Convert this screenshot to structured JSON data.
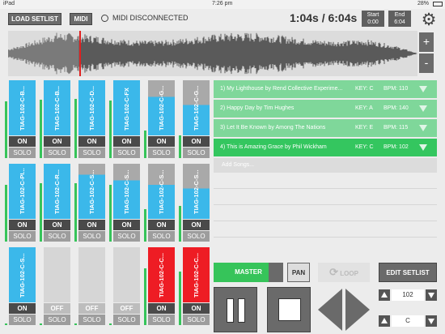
{
  "status": {
    "device": "iPad",
    "time": "7:26 pm",
    "battery": "28%"
  },
  "toolbar": {
    "load_setlist": "LOAD SETLIST",
    "midi": "MIDI",
    "midi_status": "MIDI DISCONNECTED",
    "timecode": "1:04s / 6:04s",
    "start_label": "Start",
    "start_value": "0:00",
    "end_label": "End",
    "end_value": "6:04"
  },
  "zoom": {
    "plus": "+",
    "minus": "-"
  },
  "tracks": [
    {
      "name": "TIAG-102-C-B...",
      "state": "ON",
      "solo": "SOLO",
      "color": "#3bb8ea"
    },
    {
      "name": "TIAG-102-C-B...",
      "state": "ON",
      "solo": "SOLO",
      "color": "#3bb8ea"
    },
    {
      "name": "TIAG-102-C-D...",
      "state": "ON",
      "solo": "SOLO",
      "color": "#3bb8ea"
    },
    {
      "name": "TIAG-102-C-FX",
      "state": "ON",
      "solo": "SOLO",
      "color": "#3bb8ea"
    },
    {
      "name": "TIAG-102-C-G...",
      "state": "ON",
      "solo": "SOLO",
      "color": "#3bb8ea"
    },
    {
      "name": "TIAG-102-C-G...",
      "state": "ON",
      "solo": "SOLO",
      "color": "#3bb8ea"
    },
    {
      "name": "TIAG-102-C-PI...",
      "state": "ON",
      "solo": "SOLO",
      "color": "#3bb8ea"
    },
    {
      "name": "TIAG-102-C-R...",
      "state": "ON",
      "solo": "SOLO",
      "color": "#3bb8ea"
    },
    {
      "name": "TIAG-102-C-S...",
      "state": "ON",
      "solo": "SOLO",
      "color": "#3bb8ea"
    },
    {
      "name": "TIAG-102-C-S...",
      "state": "ON",
      "solo": "SOLO",
      "color": "#3bb8ea"
    },
    {
      "name": "TIAG-102-C-S...",
      "state": "ON",
      "solo": "SOLO",
      "color": "#3bb8ea"
    },
    {
      "name": "TIAG-102-C-S...",
      "state": "ON",
      "solo": "SOLO",
      "color": "#3bb8ea"
    },
    {
      "name": "TIAG-102-C-S...",
      "state": "ON",
      "solo": "SOLO",
      "color": "#3bb8ea"
    },
    {
      "name": "",
      "state": "OFF",
      "solo": "SOLO",
      "color": "#d6d6d6"
    },
    {
      "name": "",
      "state": "OFF",
      "solo": "SOLO",
      "color": "#d6d6d6"
    },
    {
      "name": "",
      "state": "OFF",
      "solo": "SOLO",
      "color": "#d6d6d6"
    },
    {
      "name": "TIAG-102-C-C...",
      "state": "ON",
      "solo": "SOLO",
      "color": "#ee1c24"
    },
    {
      "name": "TIAG-102-C-C...",
      "state": "ON",
      "solo": "SOLO",
      "color": "#ee1c24"
    }
  ],
  "songs": [
    {
      "title": "1) My Lighthouse by Rend Collective Experime...",
      "key": "KEY: C",
      "bpm": "BPM: 110",
      "color": "#7fd79a"
    },
    {
      "title": "2) Happy Day  by Tim Hughes",
      "key": "KEY: A",
      "bpm": "BPM: 140",
      "color": "#7fd79a"
    },
    {
      "title": "3) Let It Be Known  by Among The Nations",
      "key": "KEY: E",
      "bpm": "BPM: 115",
      "color": "#7fd79a"
    },
    {
      "title": "4) This is Amazing Grace by Phil Wickham",
      "key": "KEY: C",
      "bpm": "BPM: 102",
      "color": "#34c65f"
    }
  ],
  "add_songs": "Add Songs...",
  "controls": {
    "master": "MASTER",
    "pan": "PAN",
    "loop": "LOOP",
    "edit_setlist": "EDIT SETLIST",
    "bpm_value": "102",
    "key_value": "C"
  }
}
